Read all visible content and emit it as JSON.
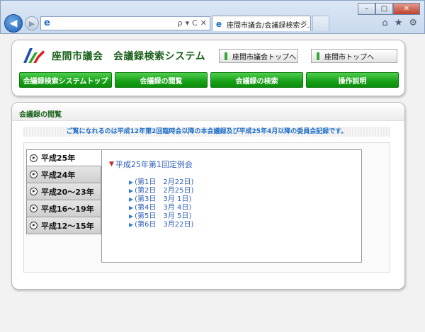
{
  "browser": {
    "tab_title": "座間市議会/会議録検索シ...",
    "tab_close": "×",
    "address_tools": [
      "ρ",
      "▾",
      "C",
      "✕"
    ],
    "window_buttons": [
      "–",
      "□",
      "✕"
    ],
    "toolbar_icons": [
      "⌂",
      "★",
      "⚙"
    ]
  },
  "header": {
    "site_title": "座間市議会　会議録検索システム",
    "top_links": [
      {
        "label": "座間市議会トップへ"
      },
      {
        "label": "座間市トップへ"
      }
    ],
    "nav": [
      {
        "label": "会議録検索システムトップ"
      },
      {
        "label": "会議録の閲覧"
      },
      {
        "label": "会議録の検索"
      },
      {
        "label": "操作説明"
      }
    ]
  },
  "content": {
    "section_title": "会議録の閲覧",
    "notice": "ご覧になれるのは平成12年第2回臨時会以降の本会議録及び平成25年4月以降の委員会記録です。",
    "year_tabs": [
      {
        "label": "平成25年",
        "active": true
      },
      {
        "label": "平成24年",
        "active": false
      },
      {
        "label": "平成20～23年",
        "active": false
      },
      {
        "label": "平成16～19年",
        "active": false
      },
      {
        "label": "平成12～15年",
        "active": false
      }
    ],
    "meeting_title": "平成25年第1回定例会",
    "dates": [
      "(第1日　2月22日)",
      "(第2日　2月25日)",
      "(第3日　3月 1日)",
      "(第4日　3月 4日)",
      "(第5日　3月 5日)",
      "(第6日　3月22日)"
    ]
  },
  "colors": {
    "accent_green": "#16a016",
    "title_green": "#1a5f1a",
    "link_blue": "#2e5fb8"
  }
}
